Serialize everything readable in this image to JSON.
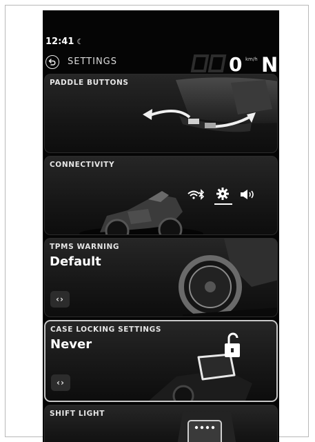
{
  "status": {
    "time": "12:41",
    "moon_icon": "☾"
  },
  "header": {
    "title": "SETTINGS",
    "speed": "0",
    "speed_unit": "km/h",
    "gear": "N"
  },
  "cards": [
    {
      "title": "PADDLE BUTTONS"
    },
    {
      "title": "CONNECTIVITY",
      "icons": [
        "bluetooth-icon",
        "gear-icon",
        "volume-icon"
      ]
    },
    {
      "title": "TPMS WARNING",
      "value": "Default",
      "nav": "‹›"
    },
    {
      "title": "CASE LOCKING SETTINGS",
      "value": "Never",
      "nav": "‹›"
    },
    {
      "title": "SHIFT LIGHT"
    }
  ]
}
